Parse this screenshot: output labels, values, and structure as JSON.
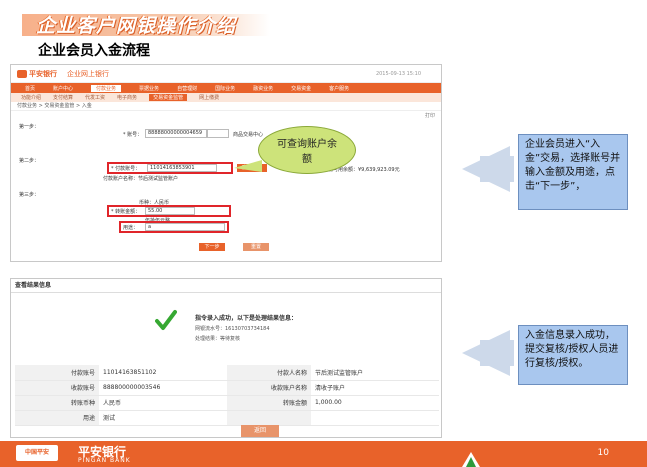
{
  "title": "企业客户网银操作介绍",
  "subtitle": "企业会员入金流程",
  "shot1": {
    "logo": "平安银行",
    "brand": "企业网上银行",
    "date": "2015-09-13  15:10",
    "nav": [
      "首页",
      "账户中心",
      "付款业务",
      "票据业务",
      "自营理财",
      "国际业务",
      "融资业务",
      "交易资金",
      "客户服务"
    ],
    "nav_active": "付款业务",
    "subnav": [
      "功能介绍",
      "支付结算",
      "代发工资",
      "电子商务",
      "交易资金监管",
      "网上缴费"
    ],
    "subnav_active": "交易资金监管",
    "breadcrumb": "付款业务 > 交易资金监管 > 入金",
    "print": "打印",
    "step1": "第一步：",
    "step2": "第二步：",
    "step3": "第三步：",
    "account_label": "* 账号：",
    "account_value": "88888000000004659",
    "account_suffix": "商品交易中心",
    "pay_account_label": "* 付款账号：",
    "pay_account_value": "11014163853901",
    "pay_name": "付款账户名称：节后测试监管账户",
    "balance": "当前可用余额：¥9,639,923.09元",
    "query_btn": "查询余额",
    "currency": "币种：人民币",
    "amount_label": "* 转账金额：",
    "amount_value": "55.00",
    "amount_cn": "伍拾伍元整",
    "purpose_label": "用途：",
    "purpose_value": "a",
    "next_btn": "下一步",
    "reset_btn": "重置"
  },
  "callout": "可查询账户余额",
  "note1": "企业会员进入“入金”交易，选择账号并输入金额及用途，点击“下一步”，",
  "note2": "入金信息录入成功，提交复核/授权人员进行复核/授权。",
  "shot2": {
    "header": "查看结果信息",
    "success": "指令录入成功，以下是处理结果信息：",
    "serial": "网银流水号：16130703734184",
    "status": "处理结果：等待复核",
    "rows": [
      {
        "k1": "付款账号",
        "v1": "11014163851102",
        "k2": "付款人名称",
        "v2": "节后测试监管账户"
      },
      {
        "k1": "收款账号",
        "v1": "888800000003546",
        "k2": "收款账户名称",
        "v2": "清收子账户"
      },
      {
        "k1": "转账币种",
        "v1": "人民币",
        "k2": "转账金额",
        "v2": "1,000.00"
      },
      {
        "k1": "用途",
        "v1": "测试",
        "k2": "",
        "v2": ""
      }
    ],
    "return_btn": "返回"
  },
  "footer": {
    "logo": "中国平安",
    "cn": "平安银行",
    "en": "PINGAN BANK",
    "page": "10"
  }
}
